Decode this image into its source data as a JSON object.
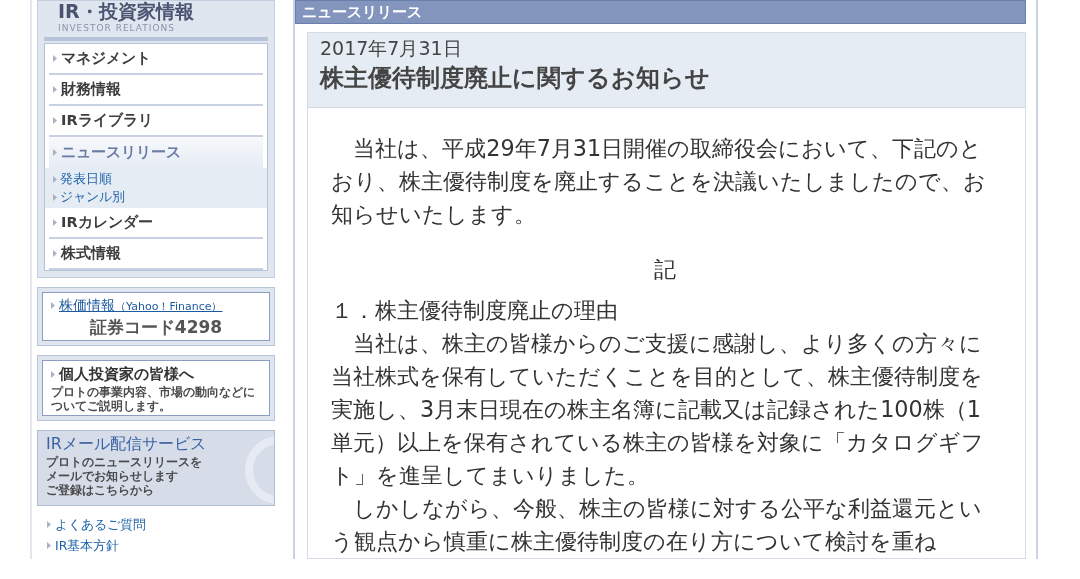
{
  "sidebar": {
    "title": "IR・投資家情報",
    "subtitle": "INVESTOR RELATIONS",
    "menu": [
      {
        "label": "マネジメント",
        "selected": false
      },
      {
        "label": "財務情報",
        "selected": false
      },
      {
        "label": "IRライブラリ",
        "selected": false
      },
      {
        "label": "ニュースリリース",
        "selected": true,
        "children": [
          {
            "label": "発表日順"
          },
          {
            "label": "ジャンル別"
          }
        ]
      },
      {
        "label": "IRカレンダー",
        "selected": false
      },
      {
        "label": "株式情報",
        "selected": false
      }
    ],
    "stock_box": {
      "link": "株価情報",
      "link_note": "（Yahoo！Finance）",
      "code": "証券コード4298"
    },
    "investor_box": {
      "title": "個人投資家の皆様へ",
      "lines": [
        "プロトの事業内容、市場の動向などに",
        "ついてご説明します。"
      ]
    },
    "mail_box": {
      "title": "IRメール配信サービス",
      "lines": [
        "プロトのニュースリリースを",
        "メールでお知らせします",
        "ご登録はこちらから"
      ]
    },
    "links": [
      "よくあるご質問",
      "IR基本方針"
    ]
  },
  "main": {
    "section_title": "ニュースリリース",
    "date": "2017年7月31日",
    "title": "株主優待制度廃止に関するお知らせ",
    "blocks": [
      {
        "kind": "paragraph",
        "text": "当社は、平成29年7月31日開催の取締役会において、下記のとおり、株主優待制度を廃止することを決議いたしましたので、お知らせいたします。"
      },
      {
        "kind": "center",
        "text": "記"
      },
      {
        "kind": "heading",
        "text": "１．株主優待制度廃止の理由"
      },
      {
        "kind": "paragraph",
        "text": "当社は、株主の皆様からのご支援に感謝し、より多くの方々に当社株式を保有していただくことを目的として、株主優待制度を実施し、3月末日現在の株主名簿に記載又は記録された100株（1単元）以上を保有されている株主の皆様を対象に「カタログギフト」を進呈してまいりました。"
      },
      {
        "kind": "paragraph",
        "text": "しかしながら、今般、株主の皆様に対する公平な利益還元という観点から慎重に株主優待制度の在り方について検討を重ね"
      }
    ]
  }
}
